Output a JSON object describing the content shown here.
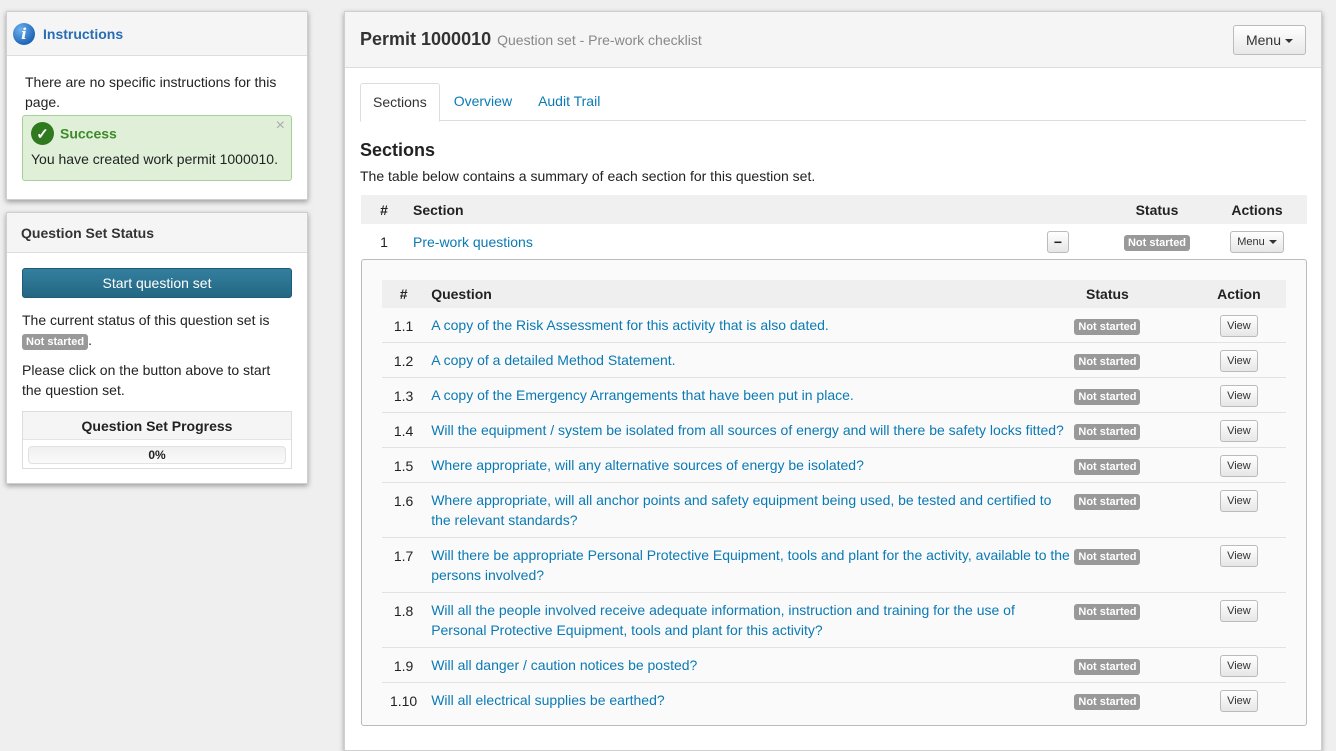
{
  "instructions": {
    "title": "Instructions",
    "icon": "info-icon",
    "text": "There are no specific instructions for this page.",
    "alert": {
      "title": "Success",
      "text": "You have created work permit 1000010.",
      "close": "×"
    }
  },
  "qs_status": {
    "title": "Question Set Status",
    "start_button": "Start question set",
    "text_before": "The current status of this question set is",
    "badge": "Not started",
    "text_after": ".",
    "instruction": "Please click on the button above to start the question set.",
    "progress_title": "Question Set Progress",
    "progress_label": "0%",
    "progress_value": 0
  },
  "main": {
    "title": "Permit 1000010",
    "subtitle": "Question set - Pre-work checklist",
    "menu_label": "Menu",
    "tabs": [
      {
        "label": "Sections"
      },
      {
        "label": "Overview"
      },
      {
        "label": "Audit Trail"
      }
    ],
    "section_heading": "Sections",
    "section_desc": "The table below contains a summary of each section for this question set.",
    "table_headers": {
      "num": "#",
      "section": "Section",
      "status": "Status",
      "actions": "Actions"
    },
    "section_row": {
      "num": "1",
      "name": "Pre-work questions",
      "toggle": "−",
      "status": "Not started",
      "menu": "Menu"
    },
    "question_headers": {
      "num": "#",
      "question": "Question",
      "status": "Status",
      "action": "Action"
    },
    "questions": [
      {
        "num": "1.1",
        "text": "A copy of the Risk Assessment for this activity that is also dated.",
        "status": "Not started",
        "action": "View"
      },
      {
        "num": "1.2",
        "text": "A copy of a detailed Method Statement.",
        "status": "Not started",
        "action": "View"
      },
      {
        "num": "1.3",
        "text": "A copy of the Emergency Arrangements that have been put in place.",
        "status": "Not started",
        "action": "View"
      },
      {
        "num": "1.4",
        "text": "Will the equipment / system be isolated from all sources of energy and will there be safety locks fitted?",
        "status": "Not started",
        "action": "View"
      },
      {
        "num": "1.5",
        "text": "Where appropriate, will any alternative sources of energy be isolated?",
        "status": "Not started",
        "action": "View"
      },
      {
        "num": "1.6",
        "text": "Where appropriate, will all anchor points and safety equipment being used, be tested and certified to the relevant standards?",
        "status": "Not started",
        "action": "View"
      },
      {
        "num": "1.7",
        "text": "Will there be appropriate Personal Protective Equipment, tools and plant for the activity, available to the persons involved?",
        "status": "Not started",
        "action": "View"
      },
      {
        "num": "1.8",
        "text": "Will all the people involved receive adequate information, instruction and training for the use of Personal Protective Equipment, tools and plant for this activity?",
        "status": "Not started",
        "action": "View"
      },
      {
        "num": "1.9",
        "text": "Will all danger / caution notices be posted?",
        "status": "Not started",
        "action": "View"
      },
      {
        "num": "1.10",
        "text": "Will all electrical supplies be earthed?",
        "status": "Not started",
        "action": "View"
      }
    ]
  }
}
